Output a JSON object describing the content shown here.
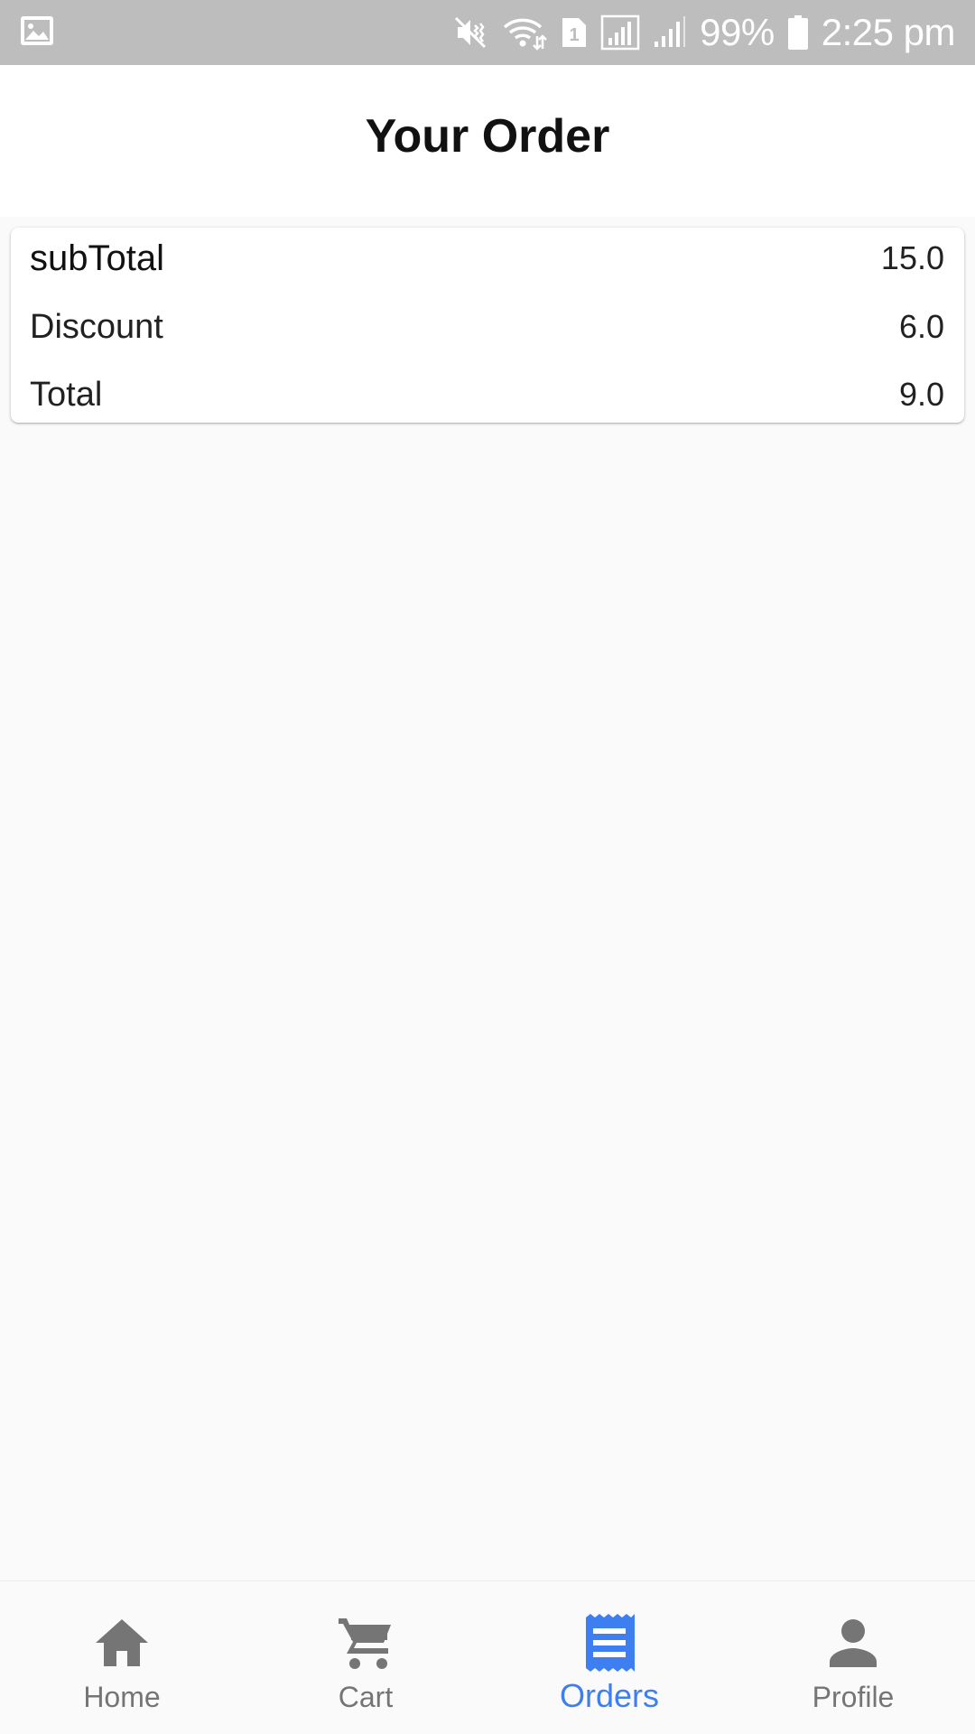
{
  "status_bar": {
    "battery": "99%",
    "time": "2:25 pm",
    "sim_badge": "1",
    "icons": [
      "gallery-icon",
      "mute-vibrate-icon",
      "wifi-icon",
      "sim-badge-icon",
      "signal-icon",
      "signal-icon-2",
      "battery-icon"
    ]
  },
  "app_bar": {
    "title": "Your Order"
  },
  "summary": {
    "rows": [
      {
        "label": "subTotal",
        "value": "15.0"
      },
      {
        "label": "Discount",
        "value": "6.0"
      },
      {
        "label": "Total",
        "value": "9.0"
      }
    ]
  },
  "bottom_nav": {
    "items": [
      {
        "label": "Home",
        "icon": "home-icon",
        "active": false
      },
      {
        "label": "Cart",
        "icon": "cart-icon",
        "active": false
      },
      {
        "label": "Orders",
        "icon": "receipt-icon",
        "active": true
      },
      {
        "label": "Profile",
        "icon": "person-icon",
        "active": false
      }
    ]
  },
  "colors": {
    "status_bar_bg": "#bdbdbd",
    "accent": "#3d7ff0",
    "inactive_nav": "#757575",
    "page_bg": "#fafafa"
  }
}
